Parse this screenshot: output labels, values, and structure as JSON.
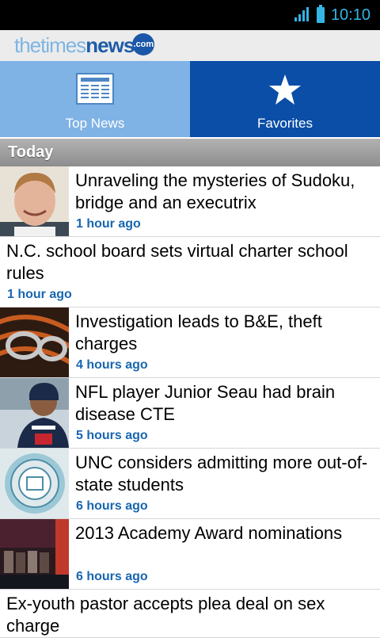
{
  "status_bar": {
    "time": "10:10",
    "signal_icon": "signal-icon",
    "battery_icon": "battery-icon"
  },
  "header": {
    "logo_part1": "thetimes",
    "logo_part2": "news",
    "logo_part3": ".com"
  },
  "tabs": [
    {
      "label": "Top News",
      "icon": "newspaper-icon",
      "selected": false,
      "color": "#7fb2e5"
    },
    {
      "label": "Favorites",
      "icon": "star-icon",
      "selected": true,
      "color": "#0a4ea8"
    }
  ],
  "section": {
    "title": "Today"
  },
  "articles": [
    {
      "headline": "Unraveling the mysteries of Sudoku, bridge and an executrix",
      "time": "1 hour ago",
      "thumb": "portrait-man"
    },
    {
      "headline": "N.C. school board sets virtual charter school rules",
      "time": "1 hour ago"
    },
    {
      "headline": "Investigation leads to B&E, theft charges",
      "time": "4 hours ago",
      "thumb": "handcuffs"
    },
    {
      "headline": "NFL player Junior Seau had brain disease CTE",
      "time": "5 hours ago",
      "thumb": "football-player"
    },
    {
      "headline": "UNC considers admitting more out-of-state students",
      "time": "6 hours ago",
      "thumb": "university-seal"
    },
    {
      "headline": "2013 Academy Award nominations",
      "time": "6 hours ago",
      "thumb": "stage-event"
    },
    {
      "headline": "Ex-youth pastor accepts plea deal on sex charge",
      "time": ""
    }
  ]
}
